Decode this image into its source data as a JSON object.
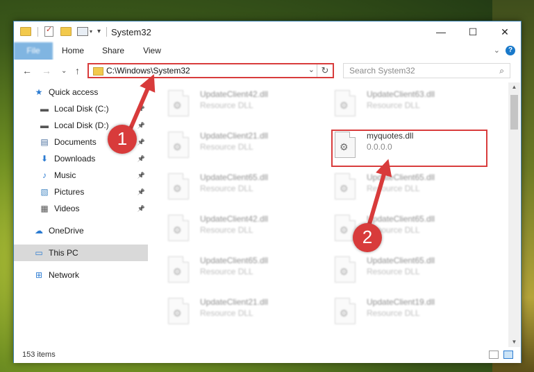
{
  "window": {
    "title": "System32",
    "minimize": "—",
    "maximize": "☐",
    "close": "✕"
  },
  "ribbon": {
    "tabs": [
      "File",
      "Home",
      "Share",
      "View"
    ],
    "expand": "⌄",
    "help": "?"
  },
  "nav": {
    "back": "←",
    "forward": "→",
    "recent": "⌄",
    "up": "↑",
    "address": "C:\\Windows\\System32",
    "address_dropdown": "⌄",
    "refresh": "↻",
    "search_placeholder": "Search System32"
  },
  "sidebar": {
    "items": [
      {
        "label": "Quick access",
        "icon": "star-icon",
        "pinned": false
      },
      {
        "label": "Local Disk (C:)",
        "icon": "drive-icon",
        "pinned": true
      },
      {
        "label": "Local Disk (D:)",
        "icon": "drive-icon",
        "pinned": true
      },
      {
        "label": "Documents",
        "icon": "documents-icon",
        "pinned": true
      },
      {
        "label": "Downloads",
        "icon": "download-icon",
        "pinned": true
      },
      {
        "label": "Music",
        "icon": "music-icon",
        "pinned": true
      },
      {
        "label": "Pictures",
        "icon": "pictures-icon",
        "pinned": true
      },
      {
        "label": "Videos",
        "icon": "videos-icon",
        "pinned": true
      },
      {
        "label": "OneDrive",
        "icon": "cloud-icon",
        "pinned": false
      },
      {
        "label": "This PC",
        "icon": "computer-icon",
        "pinned": false,
        "selected": true
      },
      {
        "label": "Network",
        "icon": "network-icon",
        "pinned": false
      }
    ]
  },
  "files": [
    {
      "name": "UpdateClient42.dll",
      "desc": "Resource DLL"
    },
    {
      "name": "UpdateClient63.dll",
      "desc": "Resource DLL"
    },
    {
      "name": "UpdateClient21.dll",
      "desc": "Resource DLL"
    },
    {
      "name": "myquotes.dll",
      "desc": "0.0.0.0",
      "highlighted": true
    },
    {
      "name": "UpdateClient65.dll",
      "desc": "Resource DLL"
    },
    {
      "name": "UpdateClient65.dll",
      "desc": "Resource DLL"
    },
    {
      "name": "UpdateClient42.dll",
      "desc": "Resource DLL"
    },
    {
      "name": "UpdateClient65.dll",
      "desc": "Resource DLL"
    },
    {
      "name": "UpdateClient65.dll",
      "desc": "Resource DLL"
    },
    {
      "name": "UpdateClient65.dll",
      "desc": "Resource DLL"
    },
    {
      "name": "UpdateClient21.dll",
      "desc": "Resource DLL"
    },
    {
      "name": "UpdateClient19.dll",
      "desc": "Resource DLL"
    }
  ],
  "status": {
    "item_count": "153 items"
  },
  "callouts": {
    "step1": "1",
    "step2": "2",
    "color": "#d83b3b"
  },
  "colors": {
    "accent": "#1979ca",
    "highlight": "#d83b3b"
  }
}
